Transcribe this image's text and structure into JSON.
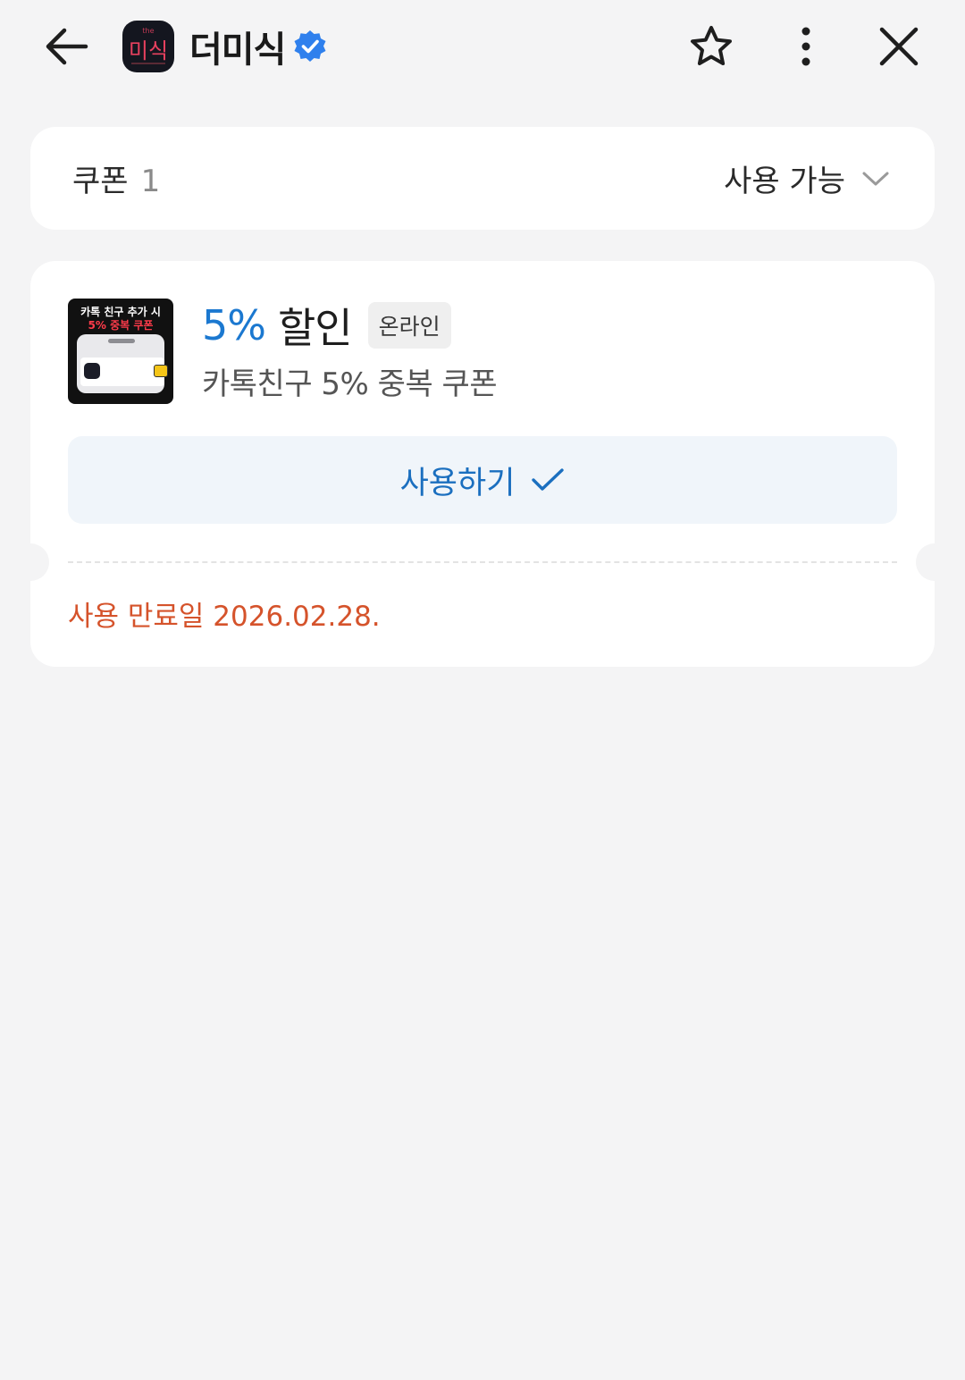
{
  "header": {
    "title": "더미식",
    "logo_text": "미식",
    "icons": [
      "back-arrow-icon",
      "verified-badge-icon",
      "star-icon",
      "more-vertical-icon",
      "close-icon"
    ]
  },
  "filter": {
    "label": "쿠폰",
    "count": "1",
    "status_label": "사용 가능",
    "status_icon": "chevron-down-icon"
  },
  "coupon": {
    "thumbnail": {
      "line1": "카톡 친구 추가 시",
      "line2": "5% 중복 쿠폰"
    },
    "discount_value": "5%",
    "discount_label": "할인",
    "badge": "온라인",
    "description": "카톡친구 5% 중복 쿠폰",
    "use_button_label": "사용하기",
    "use_button_icon": "check-icon",
    "expiry": "사용 만료일 2026.02.28."
  },
  "colors": {
    "background": "#f4f4f5",
    "card": "#ffffff",
    "accent_blue": "#1b78d0",
    "verified_blue": "#2f80ed",
    "expiry_orange": "#d5532b",
    "button_bg": "#f0f5fa"
  }
}
